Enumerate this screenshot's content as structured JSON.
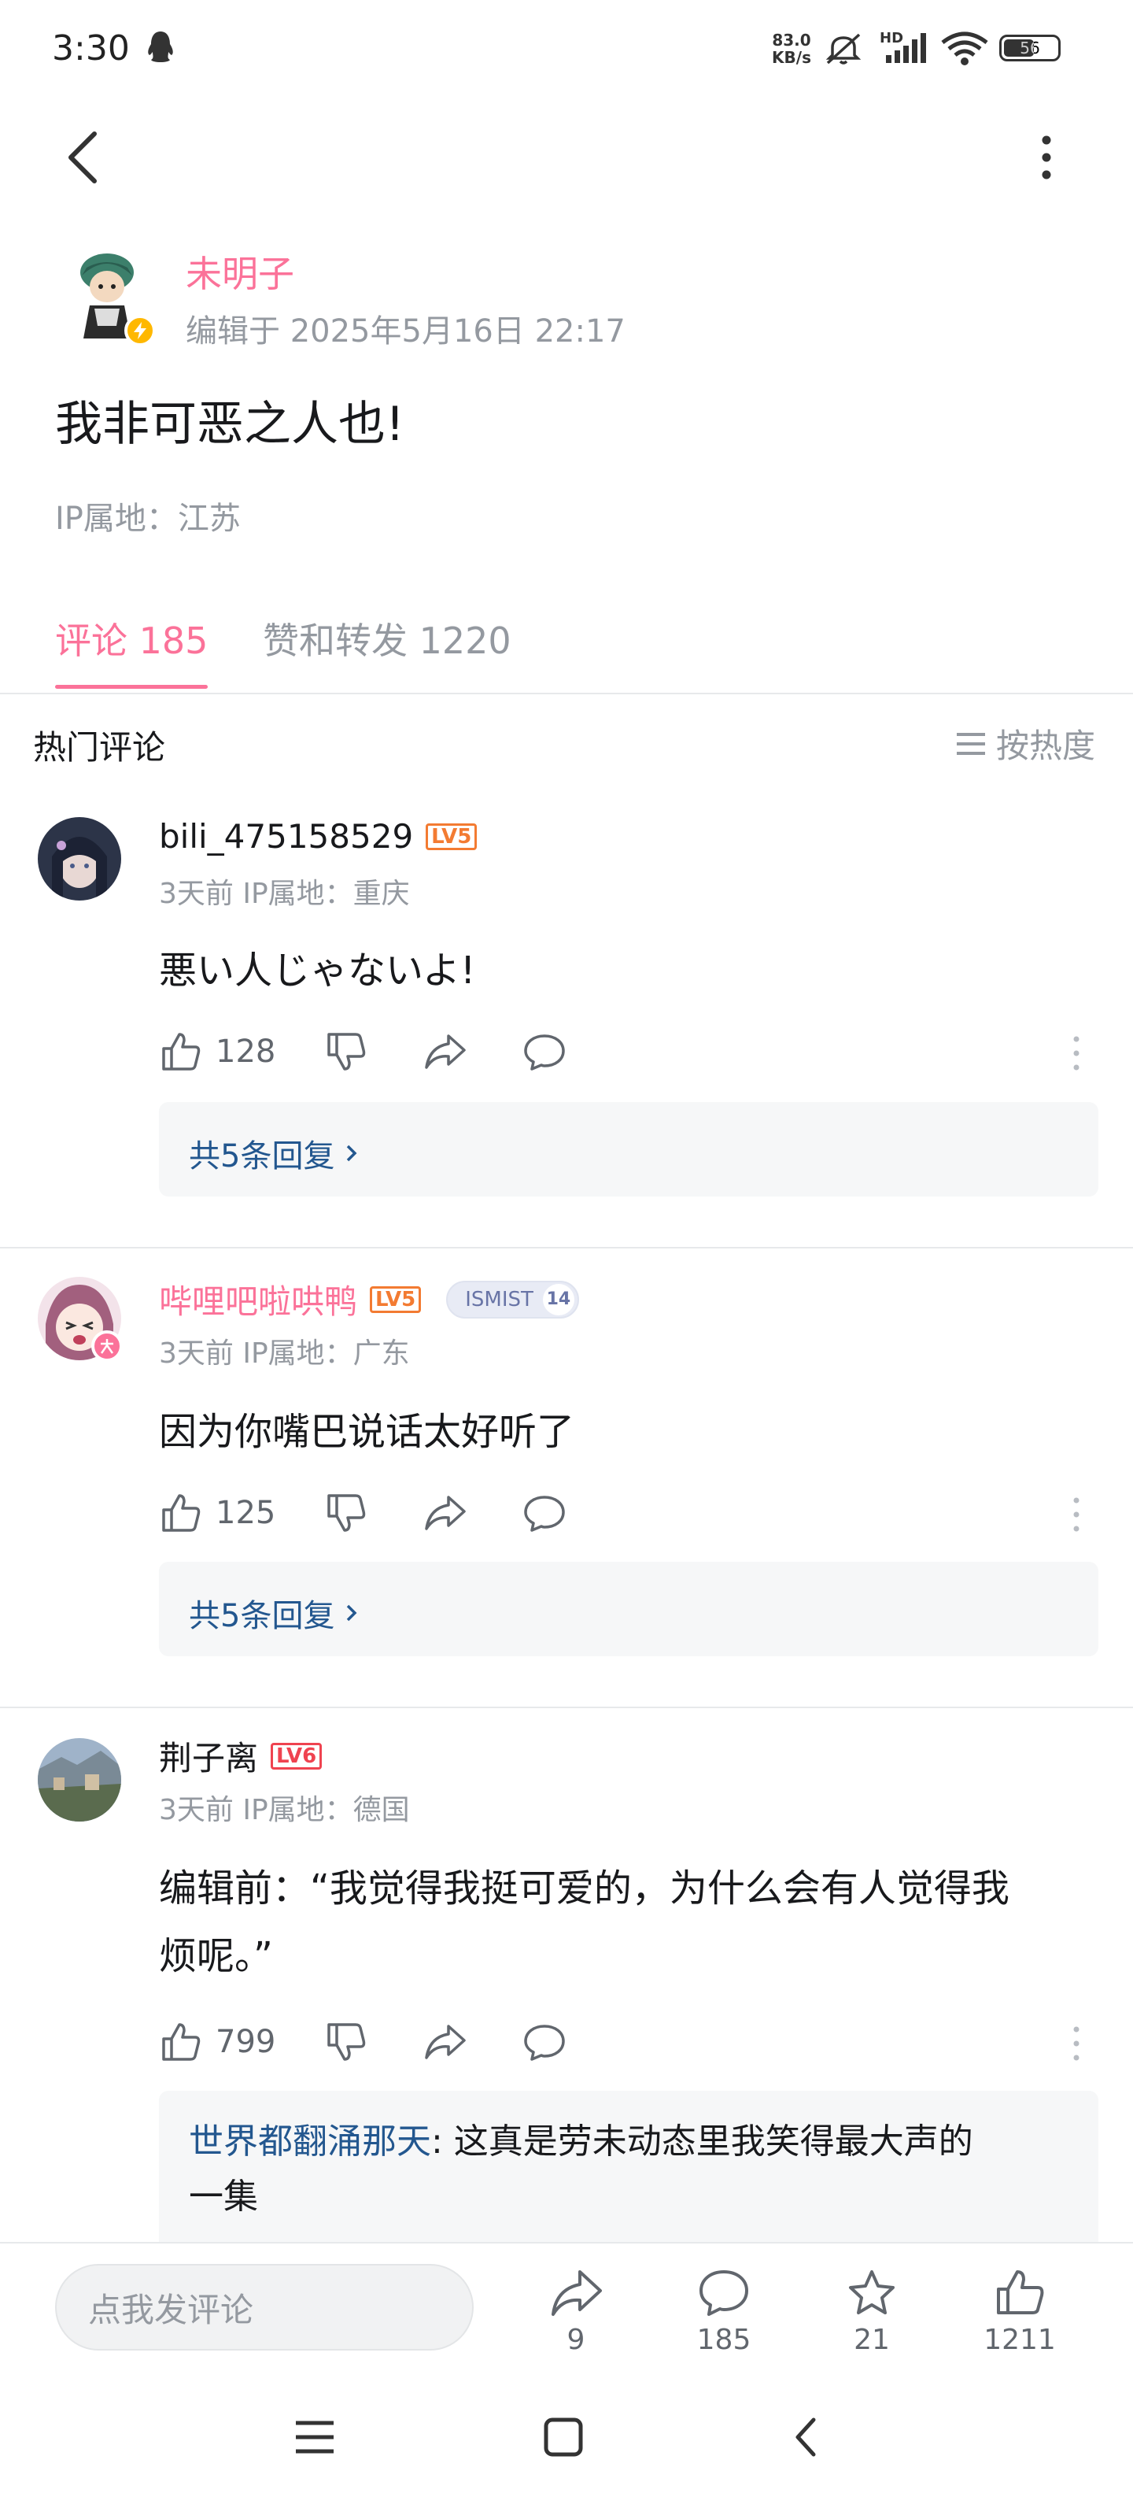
{
  "status_bar": {
    "time": "3:30",
    "net_speed_value": "83.0",
    "net_speed_unit": "KB/s",
    "signal_label": "HD",
    "battery": "56",
    "icons": [
      "qq-icon",
      "mute-icon",
      "signal-icon",
      "wifi-icon",
      "battery-icon"
    ]
  },
  "top_bar": {
    "back_icon": "chevron-left-icon",
    "more_icon": "more-vertical-icon"
  },
  "post": {
    "author_name": "未明子",
    "edit_time": "编辑于 2025年5月16日 22:17",
    "text": "我非可恶之人也!",
    "ip_location": "IP属地：江苏"
  },
  "tabs": [
    {
      "label": "评论 185",
      "active": true
    },
    {
      "label": "赞和转发 1220",
      "active": false
    }
  ],
  "hot_comments": {
    "title": "热门评论",
    "sort_label": "按热度"
  },
  "comments": [
    {
      "user": "bili_475158529",
      "level": "LV5",
      "meta": "3天前 IP属地：重庆",
      "text": "悪い人じゃないよ!",
      "likes": "128",
      "reply_summary": "共5条回复"
    },
    {
      "user": "哔哩吧啦哄鸭",
      "level": "LV5",
      "medal_name": "ISMIST",
      "medal_level": "14",
      "meta": "3天前 IP属地：广东",
      "text": "因为你嘴巴说话太好听了",
      "likes": "125",
      "reply_summary": "共5条回复"
    },
    {
      "user": "荆子离",
      "level": "LV6",
      "meta": "3天前 IP属地：德国",
      "text_line1": "编辑前：“我觉得我挺可爱的，为什么会有人觉得我",
      "text_line2": "烦呢。”",
      "likes": "799",
      "reply_preview_user": "世界都翻涌那天",
      "reply_preview_text_line1": ": 这真是劳未动态里我笑得最大声的",
      "reply_preview_text_line2": "一集"
    }
  ],
  "bottom_bar": {
    "input_placeholder": "点我发评论",
    "share_count": "9",
    "comment_count": "185",
    "favorite_count": "21",
    "like_count": "1211"
  },
  "colors": {
    "brand_pink": "#fb7299",
    "link_blue": "#23578f",
    "level_orange": "#f37b32",
    "level_red": "#ef4350",
    "text_gray": "#9499a0"
  }
}
